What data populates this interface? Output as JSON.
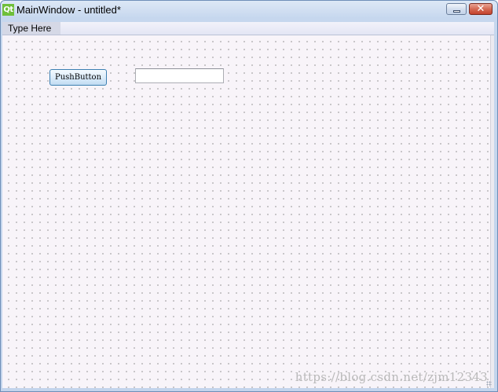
{
  "window": {
    "title": "MainWindow - untitled*",
    "app_icon": "qt-logo-icon",
    "app_icon_text": "Qt",
    "minimize_icon": "minimize-icon",
    "close_icon": "close-icon",
    "close_glyph": "✕"
  },
  "menubar": {
    "items": [
      {
        "label": "Type Here"
      }
    ]
  },
  "form": {
    "push_button_label": "PushButton",
    "line_edit_value": ""
  },
  "watermark": "https://blog.csdn.net/zjm12343",
  "colors": {
    "titlebar": "#c6d7ee",
    "canvas": "#f8f4f9",
    "close_button": "#d46a54",
    "qt_green": "#6fbf3a"
  }
}
